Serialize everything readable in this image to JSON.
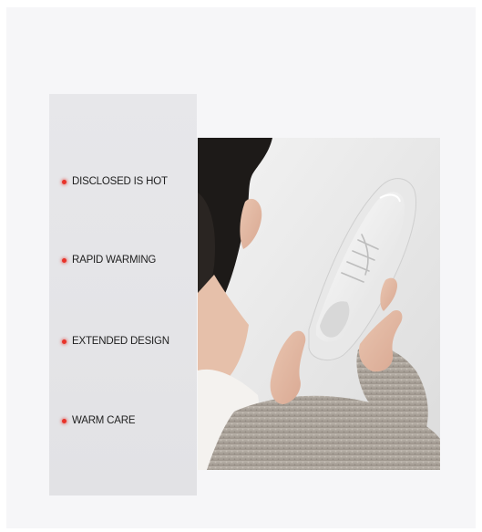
{
  "features": [
    {
      "label": "DISCLOSED IS HOT"
    },
    {
      "label": "RAPID WARMING"
    },
    {
      "label": "EXTENDED DESIGN"
    },
    {
      "label": "WARM CARE"
    }
  ],
  "colors": {
    "bullet": "#e8332a",
    "card_background": "#e4e4e7",
    "page_background": "#f6f6f8"
  },
  "photo": {
    "subject": "woman-holding-white-slip-on-sneaker-photo"
  }
}
